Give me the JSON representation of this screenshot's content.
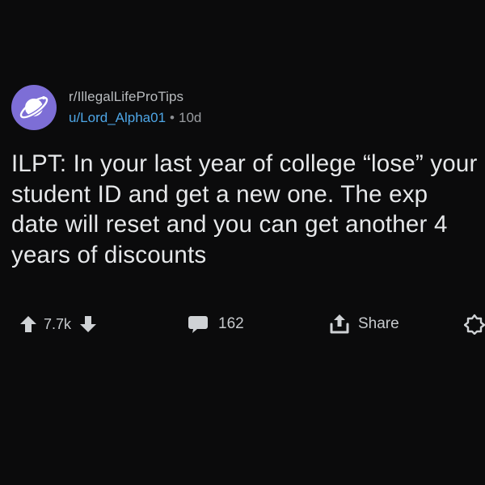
{
  "post": {
    "subreddit": "r/IllegalLifeProTips",
    "username": "u/Lord_Alpha01",
    "separator": "•",
    "age": "10d",
    "title": "ILPT: In your last year of college “lose” your student ID and get a new one. The exp date will reset and you can get another 4 years of discounts"
  },
  "actions": {
    "vote_count": "7.7k",
    "comment_count": "162",
    "share_label": "Share"
  },
  "icons": {
    "avatar": "planet-icon",
    "upvote": "arrow-up-icon",
    "downvote": "arrow-down-icon",
    "comments": "speech-bubble-icon",
    "share": "share-icon",
    "award": "award-icon"
  },
  "colors": {
    "background": "#0b0b0c",
    "avatar": "#7d6ed6",
    "username": "#4ea6e6"
  }
}
